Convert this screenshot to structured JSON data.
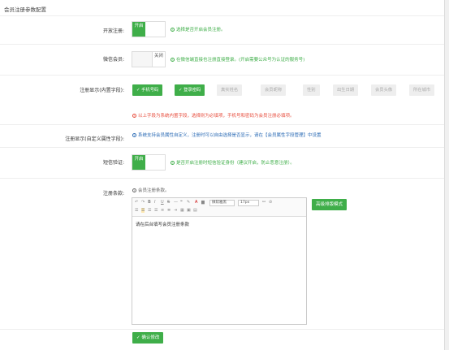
{
  "section_title": "会员注册参数配置",
  "fields": {
    "open_register": {
      "label": "开放注册:",
      "toggle_on": "开启",
      "hint": "选择是否开启会员注册。"
    },
    "wechat_member": {
      "label": "微信会员:",
      "toggle_off": "关闭",
      "hint": "在微信端直接也注册直接登录。(开启需要公众号为认证的服务号)"
    },
    "register_display": {
      "label": "注册显示(内置字段):",
      "chips": [
        {
          "label": "✓ 手机号码",
          "state": "on"
        },
        {
          "label": "✓ 登录密码",
          "state": "on"
        },
        {
          "label": "真实姓名",
          "state": "off"
        },
        {
          "label": "会员昵称",
          "state": "off"
        },
        {
          "label": "性别",
          "state": "off"
        },
        {
          "label": "出生日期",
          "state": "off"
        },
        {
          "label": "会员头像",
          "state": "off"
        },
        {
          "label": "所在城市",
          "state": "off"
        }
      ],
      "hint": "以上字段为系统内置字段，选择则为必填项，手机号和密码为会员注册必填项。"
    },
    "custom_display": {
      "label": "注册显示(自定义属性字段):",
      "hint": "系统支持会员属性自定义，注册时可以自由选择是否显示，请在【会员属性字段管理】中设置"
    },
    "sms_verify": {
      "label": "短信验证:",
      "toggle_on": "开启",
      "hint": "是否开启注册时短信验证身份（建议开启，防止恶意注册）。"
    },
    "terms": {
      "label": "注册条款:",
      "hint": "会员注册条款。",
      "font_select": "微软雅黑",
      "size_select": "17px",
      "editor_content": "请在后台填写会员注册条款",
      "advanced_button": "高级排版模式"
    }
  },
  "submit_button": "✓ 确认修改",
  "colors": {
    "accent": "#3fae49",
    "danger": "#e74c3c",
    "link": "#2b6bb5"
  }
}
